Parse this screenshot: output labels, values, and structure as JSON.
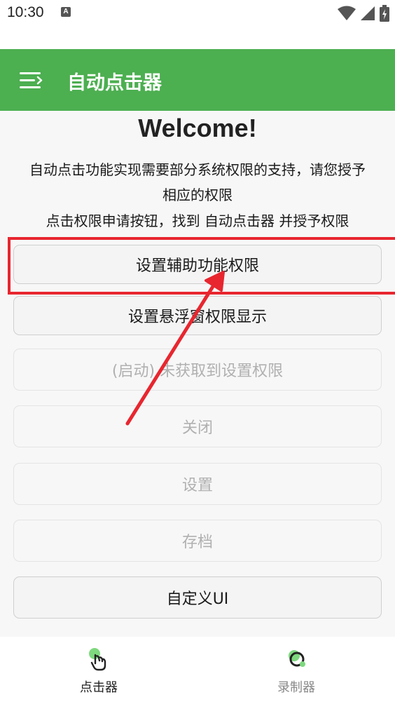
{
  "status_bar": {
    "time": "10:30",
    "notif_letter": "A"
  },
  "app_bar": {
    "title": "自动点击器",
    "menu_icon": "menu-icon"
  },
  "main": {
    "welcome": "Welcome!",
    "desc_line1": "自动点击功能实现需要部分系统权限的支持，请您授予",
    "desc_line2": "相应的权限",
    "hint": "点击权限申请按钮，找到 自动点击器 并授予权限"
  },
  "buttons": {
    "accessibility": "设置辅助功能权限",
    "overlay": "设置悬浮窗权限显示",
    "start": "(启动) 未获取到设置权限",
    "close": "关闭",
    "settings": "设置",
    "archive": "存档",
    "custom_ui": "自定义UI"
  },
  "bottom_nav": {
    "clicker": "点击器",
    "recorder": "录制器"
  },
  "colors": {
    "accent": "#4caf50",
    "highlight": "#e8262f",
    "nav_active": "#222222",
    "nav_inactive": "#888888"
  }
}
